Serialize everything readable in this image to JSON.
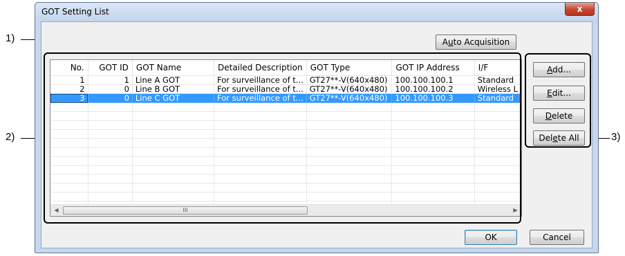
{
  "window": {
    "title": "GOT Setting List",
    "close_glyph": "x"
  },
  "callouts": {
    "c1": "1)",
    "c2": "2)",
    "c3": "3)"
  },
  "buttons": {
    "auto_acquisition": {
      "pre": "A",
      "mn": "u",
      "post": "to Acquisition"
    },
    "add": {
      "pre": "",
      "mn": "A",
      "post": "dd..."
    },
    "edit": {
      "pre": "",
      "mn": "E",
      "post": "dit..."
    },
    "delete": {
      "pre": "",
      "mn": "D",
      "post": "elete"
    },
    "delete_all": {
      "pre": "Del",
      "mn": "e",
      "post": "te All"
    },
    "ok": "OK",
    "cancel": "Cancel"
  },
  "table": {
    "columns": [
      "No.",
      "GOT ID",
      "GOT Name",
      "Detailed Description",
      "GOT Type",
      "GOT IP Address",
      "I/F"
    ],
    "rows": [
      {
        "no": "1",
        "id": "1",
        "name": "Line A GOT",
        "desc": "For surveillance of t...",
        "type": "GT27**-V(640x480)",
        "ip": "100.100.100.1",
        "if": "Standard"
      },
      {
        "no": "2",
        "id": "0",
        "name": "Line B GOT",
        "desc": "For surveillance of t...",
        "type": "GT27**-V(640x480)",
        "ip": "100.100.100.2",
        "if": "Wireless L"
      },
      {
        "no": "3",
        "id": "0",
        "name": "Line C GOT",
        "desc": "For surveillance of t...",
        "type": "GT27**-V(640x480)",
        "ip": "100.100.100.3",
        "if": "Standard"
      }
    ],
    "selected_row": "3"
  },
  "scrollbar": {
    "left_icon": "scroll-left-arrow-icon",
    "right_icon": "scroll-right-arrow-icon",
    "thumb_grip": "III"
  }
}
